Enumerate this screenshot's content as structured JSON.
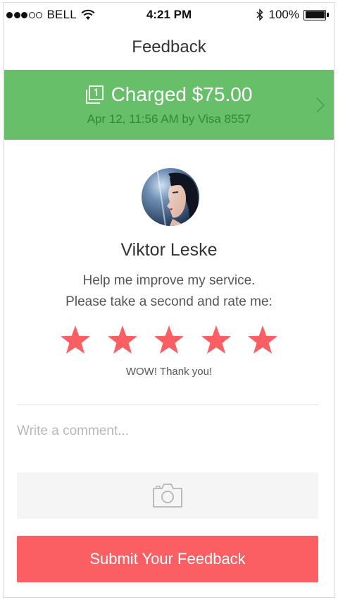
{
  "status_bar": {
    "carrier": "BELL",
    "time": "4:21 PM",
    "battery": "100%",
    "signal_bars": 3
  },
  "nav": {
    "title": "Feedback"
  },
  "charge": {
    "title": "Charged $75.00",
    "subtitle": "Apr 12, 11:56 AM by Visa 8557",
    "icon": "receipt-icon",
    "color": "#67bf6a"
  },
  "profile": {
    "name": "Viktor Leske",
    "prompt_line1": "Help me improve my service.",
    "prompt_line2": "Please take a second and rate me:"
  },
  "rating": {
    "value": 5,
    "max": 5,
    "label": "WOW! Thank you!",
    "star_color": "#fb5f63"
  },
  "comment": {
    "placeholder": "Write a comment...",
    "value": ""
  },
  "photo": {
    "icon": "camera-icon"
  },
  "submit": {
    "label": "Submit Your Feedback",
    "color": "#fb5f63"
  }
}
